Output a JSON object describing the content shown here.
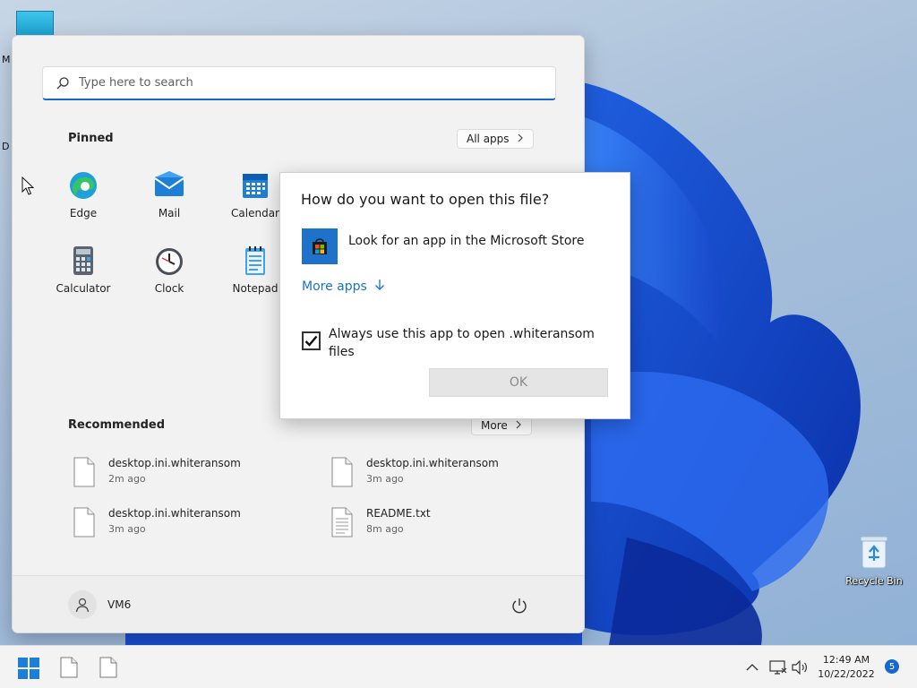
{
  "desktop": {
    "edge_labels": [
      "M",
      "D"
    ],
    "recycle_bin_label": "Recycle Bin"
  },
  "start_menu": {
    "search_placeholder": "Type here to search",
    "pinned_title": "Pinned",
    "all_apps_label": "All apps",
    "pinned_apps": [
      {
        "label": "Edge",
        "icon": "edge-icon"
      },
      {
        "label": "Mail",
        "icon": "mail-icon"
      },
      {
        "label": "Calendar",
        "icon": "calendar-icon"
      },
      {
        "label": "Calculator",
        "icon": "calculator-icon"
      },
      {
        "label": "Clock",
        "icon": "clock-icon"
      },
      {
        "label": "Notepad",
        "icon": "notepad-icon"
      }
    ],
    "recommended_title": "Recommended",
    "more_label": "More",
    "recommended_items": [
      {
        "name": "desktop.ini.whiteransom",
        "time": "2m ago"
      },
      {
        "name": "desktop.ini.whiteransom",
        "time": "3m ago"
      },
      {
        "name": "desktop.ini.whiteransom",
        "time": "3m ago"
      },
      {
        "name": "README.txt",
        "time": "8m ago"
      }
    ],
    "user_name": "VM6"
  },
  "dialog": {
    "title": "How do you want to open this file?",
    "store_option": "Look for an app in the Microsoft Store",
    "more_apps": "More apps",
    "always_use_text": "Always use this app to open .whiteransom files",
    "always_use_checked": true,
    "ok_label": "OK"
  },
  "taskbar": {
    "time": "12:49 AM",
    "date": "10/22/2022",
    "notification_count": "5"
  },
  "colors": {
    "accent": "#1868c9",
    "link": "#1a73c4",
    "store_tile": "#1e72c9"
  }
}
